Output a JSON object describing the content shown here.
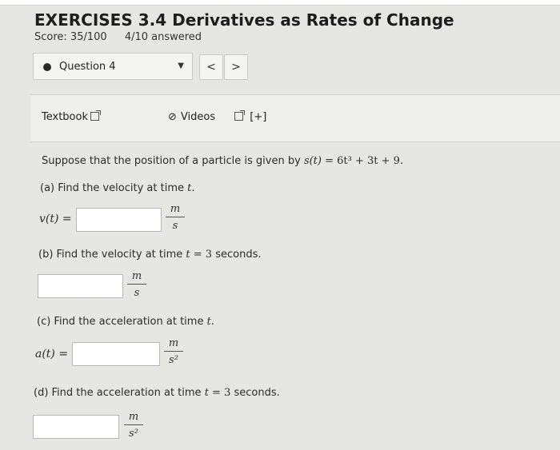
{
  "header": {
    "title": "EXERCISES 3.4 Derivatives as Rates of Change",
    "score": "Score: 35/100",
    "answered": "4/10 answered"
  },
  "question_nav": {
    "label": "Question 4",
    "prev": "<",
    "next": ">"
  },
  "toolbar": {
    "textbook": "Textbook",
    "videos": "Videos",
    "plus": "[+]"
  },
  "problem": {
    "intro": "Suppose that the position of a particle is given by",
    "func_lhs": "s(t)",
    "eq": " = ",
    "func_rhs": "6t³ + 3t + 9.",
    "a_label": "(a) Find the velocity at time ",
    "a_var": "t.",
    "a_lhs": "v(t) =",
    "unit_m": "m",
    "unit_s": "s",
    "unit_s2": "s²",
    "b_label": "(b) Find the velocity at time ",
    "b_var": "t",
    "b_eq": " = 3",
    "b_suffix": " seconds.",
    "c_label": "(c) Find the acceleration at time ",
    "c_var": "t.",
    "c_lhs": "a(t) =",
    "d_label": "(d) Find the acceleration at time ",
    "d_var": "t",
    "d_eq": " = 3",
    "d_suffix": " seconds."
  }
}
